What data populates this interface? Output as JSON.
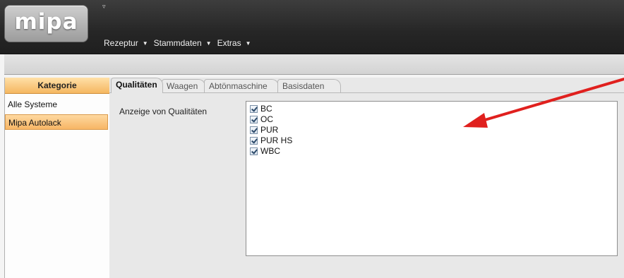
{
  "app": {
    "logo_text": "mipa",
    "qat_icon": "quick-access-dropdown-icon"
  },
  "menu": {
    "items": [
      {
        "label": "Rezeptur"
      },
      {
        "label": "Stammdaten"
      },
      {
        "label": "Extras"
      }
    ]
  },
  "sidebar": {
    "header": "Kategorie",
    "items": [
      {
        "label": "Alle Systeme",
        "selected": false
      },
      {
        "label": "Mipa Autolack",
        "selected": true
      }
    ]
  },
  "tabs": [
    {
      "label": "Qualitäten",
      "active": true
    },
    {
      "label": "Waagen",
      "active": false
    },
    {
      "label": "Abtönmaschine",
      "active": false
    },
    {
      "label": "Basisdaten",
      "active": false
    }
  ],
  "content": {
    "field_label": "Anzeige von Qualitäten",
    "qualities": [
      {
        "label": "BC",
        "checked": true
      },
      {
        "label": "OC",
        "checked": true
      },
      {
        "label": "PUR",
        "checked": true
      },
      {
        "label": "PUR HS",
        "checked": true
      },
      {
        "label": "WBC",
        "checked": true
      }
    ]
  },
  "colors": {
    "accent_orange": "#f5b761",
    "annotation_red": "#e0201e",
    "topbar_dark": "#262626"
  }
}
